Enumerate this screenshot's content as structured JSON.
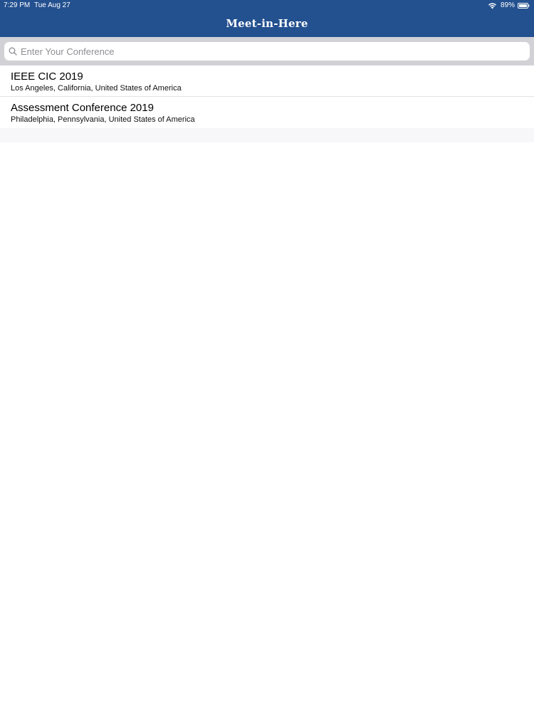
{
  "status_bar": {
    "time": "7:29 PM",
    "date": "Tue Aug 27",
    "battery": "89%",
    "wifi_icon": "wifi-icon",
    "battery_icon": "battery-icon"
  },
  "nav": {
    "title": "Meet-in-Here"
  },
  "colors": {
    "header_bg": "#23508f",
    "search_bar_bg": "#d1d1d6",
    "placeholder": "#8e8e93"
  },
  "search": {
    "placeholder": "Enter Your Conference",
    "value": "",
    "icon": "search-icon"
  },
  "conferences": [
    {
      "title": "IEEE CIC 2019",
      "location": "Los Angeles, California, United States of America"
    },
    {
      "title": "Assessment Conference 2019",
      "location": "Philadelphia, Pennsylvania, United States of America"
    }
  ]
}
